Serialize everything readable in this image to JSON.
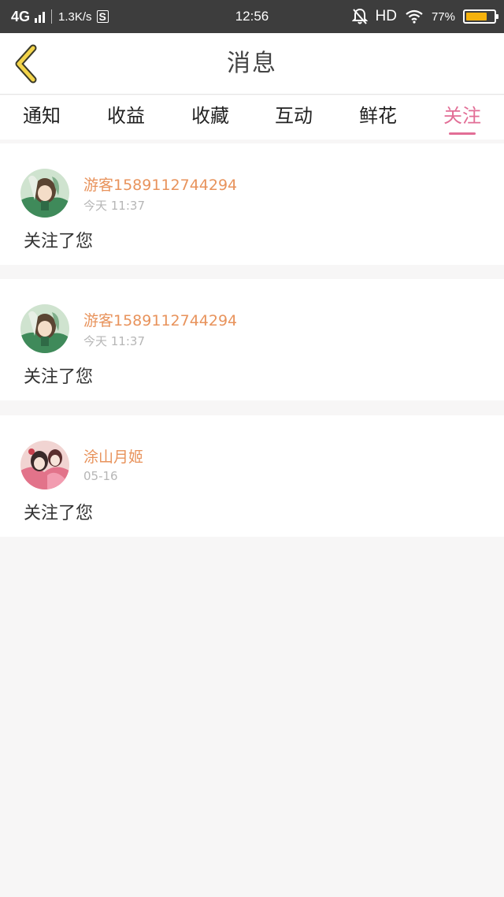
{
  "status_bar": {
    "network": "4G",
    "speed": "1.3K/s",
    "time": "12:56",
    "hd_label": "HD",
    "battery_text": "77%",
    "battery_level": 0.77,
    "battery_color": "#f5b20d",
    "icons": [
      "signal-icon",
      "s-app-icon",
      "mute-bell-icon",
      "wifi-icon",
      "battery-icon"
    ]
  },
  "header": {
    "title": "消息",
    "back_icon": "chevron-left-icon",
    "back_icon_color": "#f3d44a"
  },
  "tabs": [
    {
      "label": "通知",
      "active": false
    },
    {
      "label": "收益",
      "active": false
    },
    {
      "label": "收藏",
      "active": false
    },
    {
      "label": "互动",
      "active": false
    },
    {
      "label": "鲜花",
      "active": false
    },
    {
      "label": "关注",
      "active": true
    }
  ],
  "accent_color": "#e26e96",
  "name_color": "#e8935c",
  "messages": [
    {
      "name": "游客1589112744294",
      "time": "今天  11:37",
      "text": "关注了您",
      "avatar": "avatar-green-icon"
    },
    {
      "name": "游客1589112744294",
      "time": "今天  11:37",
      "text": "关注了您",
      "avatar": "avatar-green-icon"
    },
    {
      "name": "涂山月姬",
      "time": "05-16",
      "text": "关注了您",
      "avatar": "avatar-pink-icon"
    }
  ]
}
